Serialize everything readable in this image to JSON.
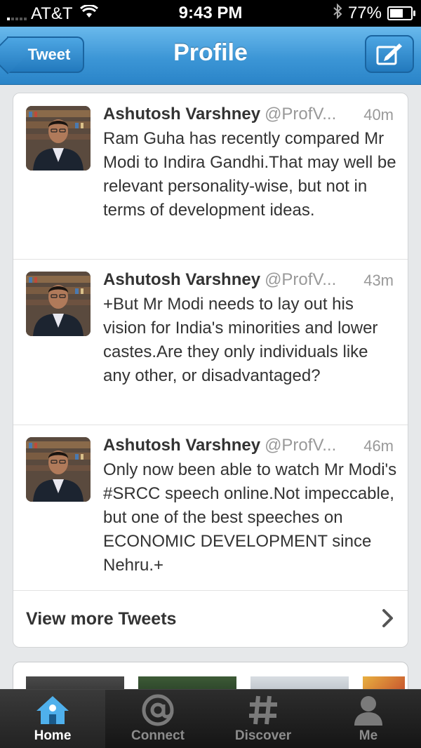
{
  "status_bar": {
    "carrier": "AT&T",
    "time": "9:43 PM",
    "battery": "77%",
    "battery_level": 0.77
  },
  "nav": {
    "back_label": "Tweet",
    "title": "Profile",
    "compose_icon": "compose-icon"
  },
  "tweets": [
    {
      "name": "Ashutosh Varshney",
      "handle": "@ProfV...",
      "time": "40m",
      "text": "Ram Guha has recently compared Mr Modi to Indira Gandhi.That may well be relevant personality-wise, but not in terms of development ideas."
    },
    {
      "name": "Ashutosh Varshney",
      "handle": "@ProfV...",
      "time": "43m",
      "text": "+But Mr Modi needs to lay out his vision for India's minorities and lower castes.Are they only individuals like any other, or disadvantaged?"
    },
    {
      "name": "Ashutosh Varshney",
      "handle": "@ProfV...",
      "time": "46m",
      "text": "Only now been able to watch Mr Modi's #SRCC speech online.Not impeccable, but one of the best speeches on ECONOMIC DEVELOPMENT since Nehru.+"
    }
  ],
  "view_more": {
    "label": "View more Tweets"
  },
  "tab_bar": {
    "tabs": [
      {
        "label": "Home",
        "icon": "home-icon",
        "active": true
      },
      {
        "label": "Connect",
        "icon": "at-icon",
        "active": false
      },
      {
        "label": "Discover",
        "icon": "hash-icon",
        "active": false
      },
      {
        "label": "Me",
        "icon": "person-icon",
        "active": false
      }
    ]
  },
  "colors": {
    "nav_blue": "#3c96d6",
    "text": "#333333",
    "muted": "#999999"
  }
}
